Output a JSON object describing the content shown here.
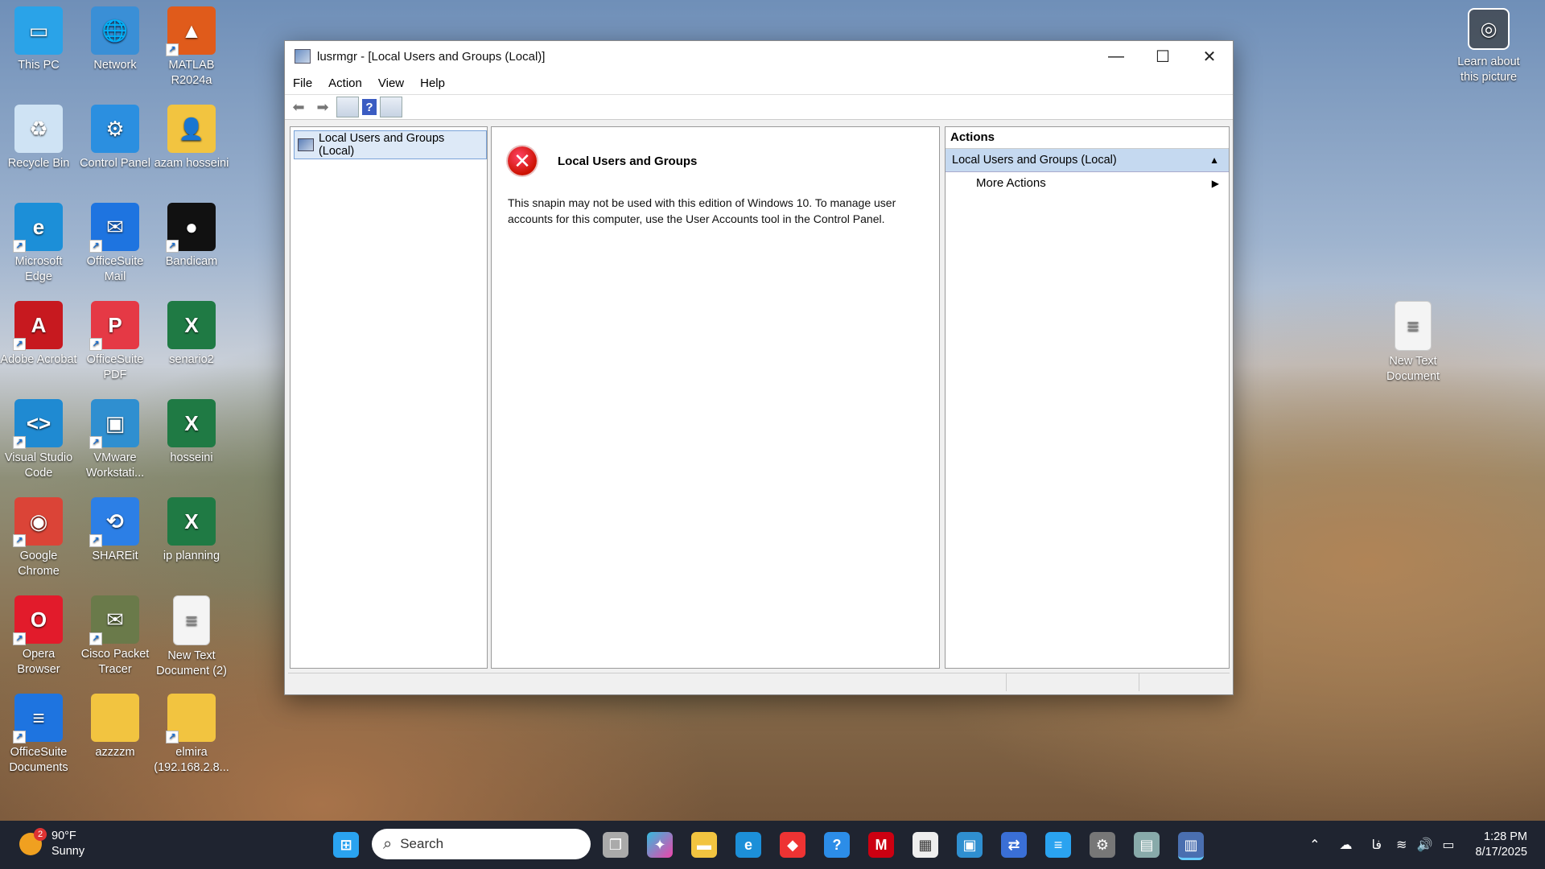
{
  "desktop": {
    "icons": [
      {
        "label": "This PC",
        "color": "#2aa3e8",
        "glyph": "▭"
      },
      {
        "label": "Network",
        "color": "#3a8fd6",
        "glyph": "🌐"
      },
      {
        "label": "MATLAB R2024a",
        "color": "#e05b1b",
        "glyph": "▲"
      },
      {
        "label": "Recycle Bin",
        "color": "#cfe3f4",
        "glyph": "♻"
      },
      {
        "label": "Control Panel",
        "color": "#2b8fe0",
        "glyph": "⚙"
      },
      {
        "label": "azam hosseini",
        "color": "#f2c440",
        "glyph": "👤"
      },
      {
        "label": "Microsoft Edge",
        "color": "#1c8fd8",
        "glyph": "e"
      },
      {
        "label": "OfficeSuite Mail",
        "color": "#1e74e0",
        "glyph": "✉"
      },
      {
        "label": "Bandicam",
        "color": "#111111",
        "glyph": "●"
      },
      {
        "label": "Adobe Acrobat",
        "color": "#c7191f",
        "glyph": "A"
      },
      {
        "label": "OfficeSuite PDF",
        "color": "#e53945",
        "glyph": "P"
      },
      {
        "label": "senario2",
        "color": "#1f7a44",
        "glyph": "X"
      },
      {
        "label": "Visual Studio Code",
        "color": "#1f8ad2",
        "glyph": "<>"
      },
      {
        "label": "VMware Workstati...",
        "color": "#2f8fd0",
        "glyph": "▣"
      },
      {
        "label": "hosseini",
        "color": "#1f7a44",
        "glyph": "X"
      },
      {
        "label": "Google Chrome",
        "color": "#db4437",
        "glyph": "◉"
      },
      {
        "label": "SHAREit",
        "color": "#2c7fe6",
        "glyph": "⟲"
      },
      {
        "label": "ip planning",
        "color": "#1f7a44",
        "glyph": "X"
      },
      {
        "label": "Opera Browser",
        "color": "#e21b2b",
        "glyph": "O"
      },
      {
        "label": "Cisco Packet Tracer",
        "color": "#6a7a4a",
        "glyph": "✉"
      },
      {
        "label": "New Text Document (2)",
        "color": "#f4f4f4",
        "glyph": "≡"
      },
      {
        "label": "OfficeSuite Documents",
        "color": "#1e74e0",
        "glyph": "≡"
      },
      {
        "label": "azzzzm",
        "color": "#f2c440",
        "glyph": ""
      },
      {
        "label": "elmira (192.168.2.8...",
        "color": "#f2c440",
        "glyph": ""
      },
      {
        "label": "New Text Document",
        "color": "#f4f4f4",
        "glyph": "≡"
      }
    ],
    "learn_label": "Learn about this picture"
  },
  "window": {
    "title": "lusrmgr - [Local Users and Groups (Local)]",
    "menu": [
      "File",
      "Action",
      "View",
      "Help"
    ],
    "tree_item": "Local Users and Groups (Local)",
    "error_title": "Local Users and Groups",
    "error_message": "This snapin may not be used with this edition of Windows 10. To manage user accounts for this computer, use the User Accounts tool in the Control Panel.",
    "actions_header": "Actions",
    "actions_selected": "Local Users and Groups (Local)",
    "actions_item": "More Actions"
  },
  "taskbar": {
    "weather_temp": "90°F",
    "weather_cond": "Sunny",
    "weather_badge": "2",
    "search_placeholder": "Search",
    "time": "1:28 PM",
    "date": "8/17/2025",
    "lang": "فا"
  }
}
